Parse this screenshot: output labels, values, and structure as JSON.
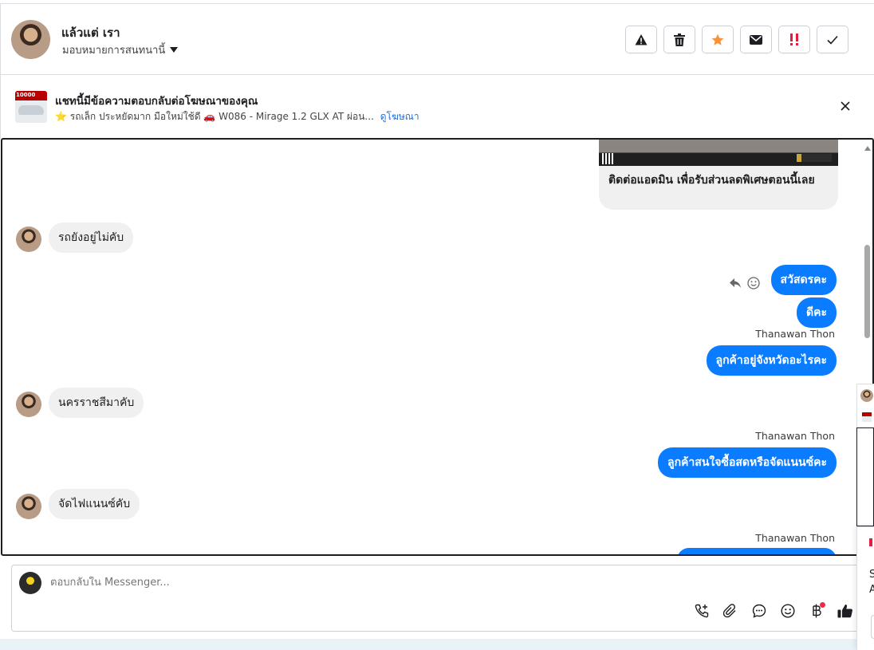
{
  "header": {
    "contact_name": "แล้วแต่ เรา",
    "assign_label": "มอบหมายการสนทนานี้",
    "actions": [
      {
        "icon": "warning-icon",
        "label": "spam"
      },
      {
        "icon": "trash-icon",
        "label": "delete"
      },
      {
        "icon": "star-icon",
        "label": "follow up"
      },
      {
        "icon": "envelope-icon",
        "label": "mark unread"
      },
      {
        "icon": "priority-icon",
        "label": "priority"
      },
      {
        "icon": "check-icon",
        "label": "done"
      }
    ]
  },
  "ad_banner": {
    "title": "แชทนี้มีข้อความตอบกลับต่อโฆษณาของคุณ",
    "subtitle": "⭐ รถเล็ก ประหยัดมาก มือใหม่ใช้ดี 🚗 W086 - Mirage 1.2 GLX AT ผ่อน...",
    "link": "ดูโฆษณา",
    "thumb_tag": "10000"
  },
  "messages": {
    "card_text": "ติดต่อแอดมิน เพื่อรับส่วนลดพิเศษตอนนี้เลย",
    "in_1": "รถยังอยู่ไม่คับ",
    "out_1": "สวัสดรคะ",
    "out_2": "ดีคะ",
    "sender_1": "Thanawan Thon",
    "out_3": "ลูกค้าอยู่จังหวัดอะไรคะ",
    "in_2": "นครราชสีมาคับ",
    "sender_2": "Thanawan Thon",
    "out_4": "ลูกค้าสนใจซื้อสดหรือจัดแนนซ์คะ",
    "in_3": "จัดไฟแนนซ์คับ",
    "sender_3": "Thanawan Thon"
  },
  "composer": {
    "placeholder": "ตอบกลับใน Messenger...",
    "tools": [
      "phone-add-icon",
      "paperclip-icon",
      "chat-bubble-icon",
      "emoji-icon",
      "baht-icon",
      "thumbs-up-icon"
    ]
  },
  "side_panel": {
    "letter_1": "S",
    "letter_2": "A"
  },
  "colors": {
    "accent": "#0a7cff",
    "incoming_bubble": "#f0f0f0",
    "link": "#216fdb",
    "notification_dot": "#f02849"
  }
}
